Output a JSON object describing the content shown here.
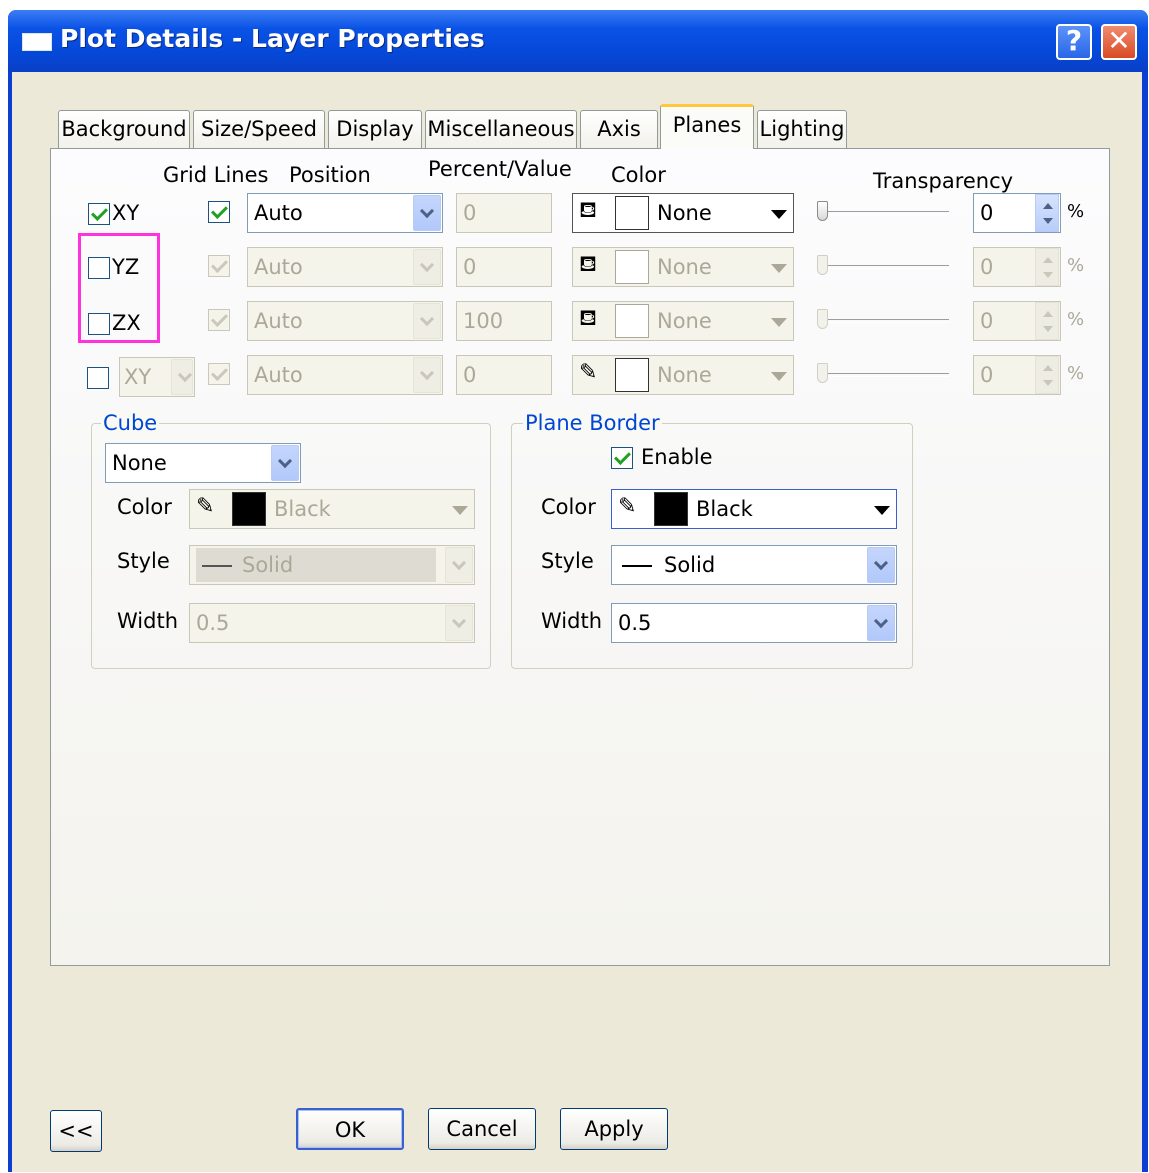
{
  "window": {
    "title": "Plot Details - Layer Properties",
    "help_label": "?",
    "close_label": "✕"
  },
  "tabs": [
    {
      "label": "Background"
    },
    {
      "label": "Size/Speed"
    },
    {
      "label": "Display"
    },
    {
      "label": "Miscellaneous"
    },
    {
      "label": "Axis"
    },
    {
      "label": "Planes",
      "active": true
    },
    {
      "label": "Lighting"
    }
  ],
  "headers": {
    "grid_lines": "Grid Lines",
    "position": "Position",
    "percent_value": "Percent/Value",
    "color": "Color",
    "transparency": "Transparency"
  },
  "planes": [
    {
      "name": "XY",
      "checked": true,
      "grid_lines": true,
      "position": "Auto",
      "percent": "0",
      "color": "None",
      "transparency": "0",
      "unit": "%",
      "enabled": true
    },
    {
      "name": "YZ",
      "checked": false,
      "grid_lines": true,
      "position": "Auto",
      "percent": "0",
      "color": "None",
      "transparency": "0",
      "unit": "%",
      "enabled": false
    },
    {
      "name": "ZX",
      "checked": false,
      "grid_lines": true,
      "position": "Auto",
      "percent": "100",
      "color": "None",
      "transparency": "0",
      "unit": "%",
      "enabled": false
    },
    {
      "name": "XY",
      "checked": false,
      "grid_lines": true,
      "position": "Auto",
      "percent": "0",
      "color": "None",
      "transparency": "0",
      "unit": "%",
      "enabled": false
    }
  ],
  "cube": {
    "title": "Cube",
    "mode": "None",
    "color_label": "Color",
    "color_value": "Black",
    "style_label": "Style",
    "style_value": "Solid",
    "width_label": "Width",
    "width_value": "0.5"
  },
  "plane_border": {
    "title": "Plane Border",
    "enable_label": "Enable",
    "enabled": true,
    "color_label": "Color",
    "color_value": "Black",
    "style_label": "Style",
    "style_value": "Solid",
    "width_label": "Width",
    "width_value": "0.5"
  },
  "buttons": {
    "collapse": "<<",
    "ok": "OK",
    "cancel": "Cancel",
    "apply": "Apply"
  },
  "colors": {
    "title_bar": "#0a52e6",
    "dialog_bg": "#ece9d8",
    "highlight_box": "#ff33dd",
    "group_title": "#0046d5",
    "active_tab_accent": "#ffc83c"
  },
  "icons": {
    "fill_color": "fill-bucket-icon",
    "line_color": "pencil-icon"
  }
}
